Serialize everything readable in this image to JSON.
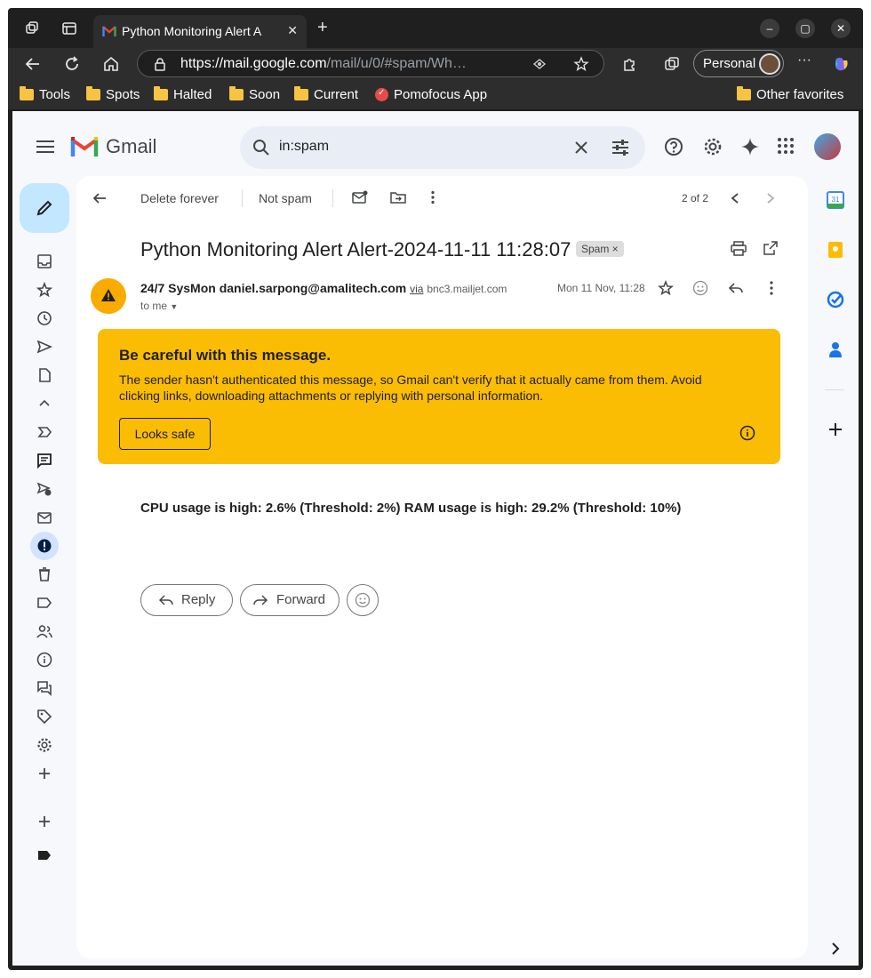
{
  "browser": {
    "tab_title": "Python Monitoring Alert A",
    "url_host": "https://mail.google.com",
    "url_path": "/mail/u/0/#spam/Wh…",
    "profile_label": "Personal",
    "bookmarks": [
      "Tools",
      "Spots",
      "Halted",
      "Soon",
      "Current",
      "Pomofocus App"
    ],
    "other_favorites": "Other favorites"
  },
  "gmail": {
    "logo_text": "Gmail",
    "search_value": "in:spam",
    "toolbar": {
      "delete_forever": "Delete forever",
      "not_spam": "Not spam",
      "pager": "2 of 2"
    },
    "message": {
      "subject": "Python Monitoring Alert Alert-2024-11-11 11:28:07",
      "label_chip": "Spam ×",
      "sender_name": "24/7 SysMon",
      "sender_email": "daniel.sarpong@amalitech.com",
      "via": "via",
      "via_domain": "bnc3.mailjet.com",
      "to": "to me",
      "date": "Mon 11 Nov, 11:28",
      "warning_title": "Be careful with this message.",
      "warning_body": "The sender hasn't authenticated this message, so Gmail can't verify that it actually came from them. Avoid clicking links, downloading attachments or replying with personal information.",
      "looks_safe": "Looks safe",
      "body": "CPU usage is high: 2.6% (Threshold: 2%) RAM usage is high: 29.2% (Threshold: 10%)",
      "reply": "Reply",
      "forward": "Forward"
    }
  },
  "colors": {
    "warning_bg": "#fbbc04",
    "compose_bg": "#c2e7ff",
    "page_bg": "#f6f8fc"
  }
}
